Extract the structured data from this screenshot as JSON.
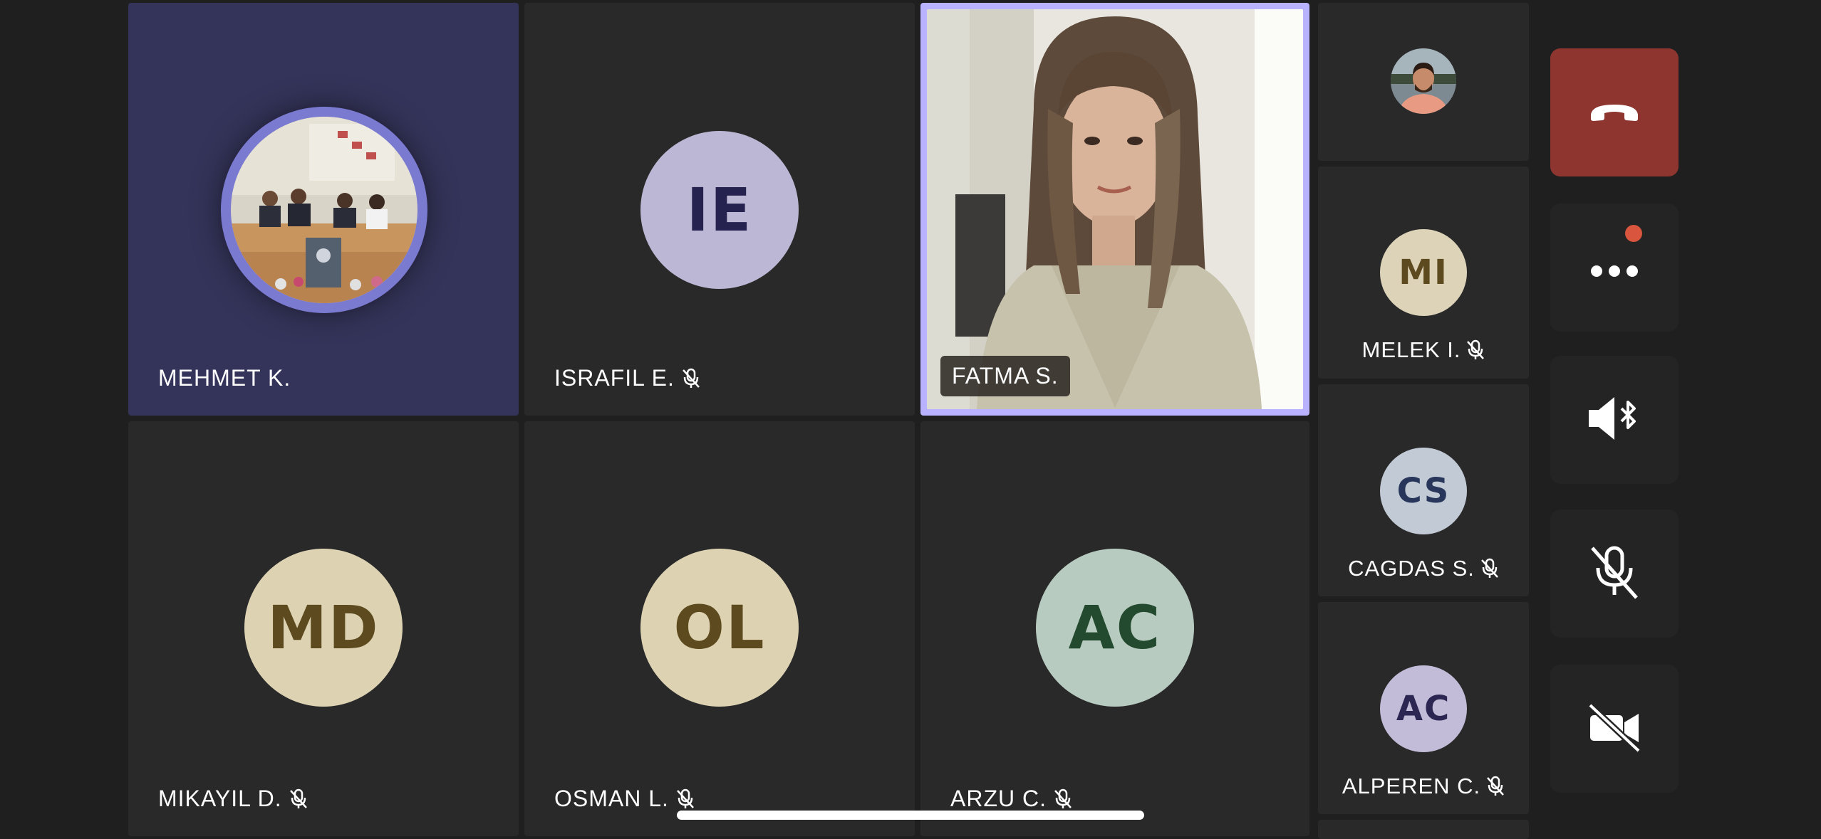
{
  "participants": {
    "mehmet": {
      "name": "MEHMET K."
    },
    "israfil": {
      "name": "ISRAFIL E.",
      "initials": "IE",
      "muted": true
    },
    "fatma": {
      "name": "FATMA S."
    },
    "mikayil": {
      "name": "MIKAYIL D.",
      "initials": "MD",
      "muted": true
    },
    "osman": {
      "name": "OSMAN L.",
      "initials": "OL",
      "muted": true
    },
    "arzu": {
      "name": "ARZU C.",
      "initials": "AC",
      "muted": true
    }
  },
  "sidebar": {
    "melek": {
      "name": "MELEK I.",
      "initials": "MI",
      "muted": true
    },
    "cagdas": {
      "name": "CAGDAS S.",
      "initials": "CS",
      "muted": true
    },
    "alperen": {
      "name": "ALPEREN C.",
      "initials": "AC",
      "muted": true
    }
  },
  "controls": {
    "hangup": {
      "icon": "phone-hangup-icon",
      "color": "#8f3530"
    },
    "more": {
      "icon": "more-dots-icon",
      "badge_color": "#d9553e"
    },
    "audio": {
      "icon": "bluetooth-speaker-icon"
    },
    "mic": {
      "icon": "mic-off-icon"
    },
    "camera": {
      "icon": "camera-off-icon"
    }
  },
  "colors": {
    "active_speaker_bg": "#34345a",
    "speaker_ring": "#7a7ad1",
    "video_border": "#b9b2ff"
  }
}
